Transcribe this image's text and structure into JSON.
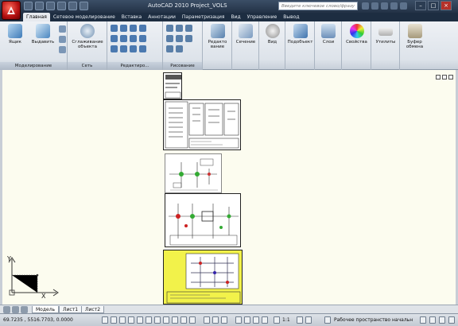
{
  "window": {
    "title": "AutoCAD 2010   Project_VOLS",
    "search_placeholder": "Введите ключевое слово/фразу",
    "min_label": "–",
    "max_label": "□",
    "close_label": "×"
  },
  "tabs": [
    "Главная",
    "Сетевое моделирование",
    "Вставка",
    "Аннотации",
    "Параметризация",
    "Вид",
    "Управление",
    "Вывод"
  ],
  "ribbon": {
    "panels": {
      "modify": "Моделирование",
      "mesh": "Сеть",
      "edit": "Редактиро...",
      "draw": "Рисование"
    },
    "buttons": {
      "box": "Ящик",
      "extrude": "Выдавить",
      "smooth": "Сглаживание объекта",
      "edit_view": "Редакто вание",
      "section": "Сечение",
      "view": "Вид",
      "subobject": "Подобъект",
      "layers": "Слои",
      "properties": "Свойства",
      "utilities": "Утилиты",
      "clipboard": "Буфер обмена"
    }
  },
  "ucs": {
    "x": "X",
    "y": "Y"
  },
  "layout_tabs": [
    "Модель",
    "Лист1",
    "Лист2"
  ],
  "status": {
    "coords": "69.7235 , 5516.7703, 0.0000",
    "scale": "1:1",
    "workspace": "Рабочее пространство начальн"
  },
  "colors": {
    "app_red": "#c0141a",
    "canvas": "#fcfcef",
    "ribbon": "#e3e8ee",
    "highlight": "#f2f24a"
  }
}
